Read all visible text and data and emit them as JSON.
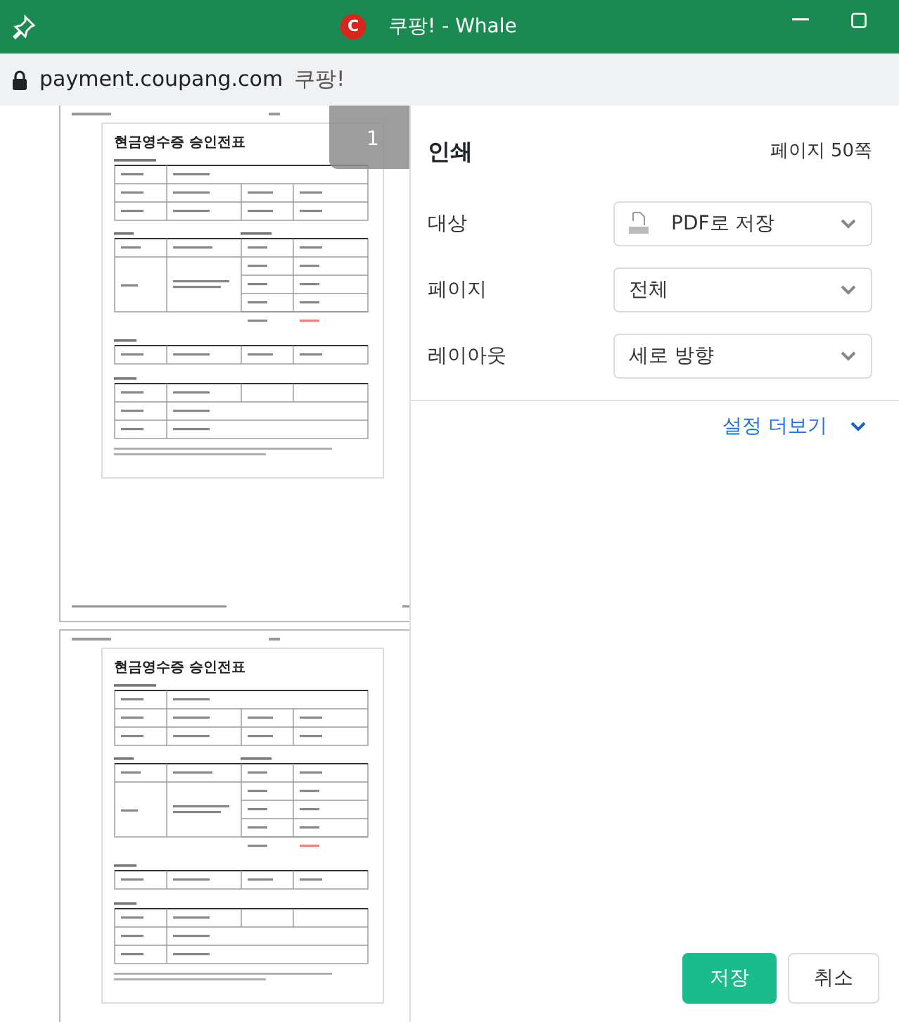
{
  "window": {
    "title": "쿠팡! - Whale",
    "logo_letter": "C"
  },
  "address_bar": {
    "domain": "payment.coupang.com",
    "page_title": "쿠팡!"
  },
  "preview": {
    "page_badge": "1",
    "pages": [
      {
        "title": "현금영수증 승인전표"
      },
      {
        "title": "현금영수증 승인전표"
      }
    ]
  },
  "print_panel": {
    "title": "인쇄",
    "page_count": "페이지 50쪽",
    "settings": [
      {
        "label": "대상",
        "value": "PDF로 저장",
        "kind": "pdf"
      },
      {
        "label": "페이지",
        "value": "전체",
        "kind": "plain"
      },
      {
        "label": "레이아웃",
        "value": "세로 방향",
        "kind": "plain"
      }
    ],
    "more_settings": {
      "label": "설정 더보기",
      "expanded": false
    },
    "buttons": [
      {
        "label": "저장",
        "kind": "primary"
      },
      {
        "label": "취소",
        "kind": "secondary"
      }
    ]
  }
}
